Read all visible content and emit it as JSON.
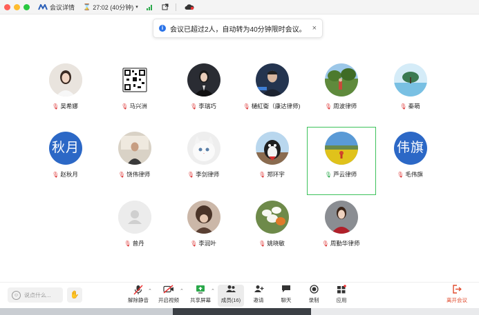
{
  "titlebar": {
    "meeting_details": "会议详情",
    "timer": "27:02 (40分钟)",
    "traffic_colors": [
      "#ff5f57",
      "#febc2e",
      "#28c840"
    ]
  },
  "toast": {
    "message": "会议已超过2人，自动转为40分钟限时会议。",
    "close": "×"
  },
  "participants": [
    {
      "name": "吴希娜",
      "mic": "muted",
      "avatar": "photo"
    },
    {
      "name": "马兴洲",
      "mic": "muted",
      "avatar": "qrcode"
    },
    {
      "name": "李瑞巧",
      "mic": "muted",
      "avatar": "photo"
    },
    {
      "name": "樋紅衛（康达律师)",
      "mic": "muted",
      "avatar": "photo"
    },
    {
      "name": "周波律师",
      "mic": "muted",
      "avatar": "photo"
    },
    {
      "name": "秦萌",
      "mic": "muted",
      "avatar": "photo"
    },
    {
      "name": "赵秋月",
      "mic": "muted",
      "avatar": "text",
      "avatar_text": "秋月"
    },
    {
      "name": "饶伟律师",
      "mic": "muted",
      "avatar": "photo"
    },
    {
      "name": "李剑律师",
      "mic": "muted",
      "avatar": "photo"
    },
    {
      "name": "郑环宇",
      "mic": "muted",
      "avatar": "photo"
    },
    {
      "name": "芦云律师",
      "mic": "on",
      "avatar": "photo",
      "active": true
    },
    {
      "name": "毛伟旗",
      "mic": "muted",
      "avatar": "text",
      "avatar_text": "伟旗"
    },
    {
      "name": "曾丹",
      "mic": "muted",
      "avatar": "default"
    },
    {
      "name": "李润叶",
      "mic": "muted",
      "avatar": "photo"
    },
    {
      "name": "姚晓敏",
      "mic": "muted",
      "avatar": "photo"
    },
    {
      "name": "周勤华律师",
      "mic": "muted",
      "avatar": "photo"
    }
  ],
  "toolbar": {
    "say_placeholder": "说点什么...",
    "unmute": "解除静音",
    "start_video": "开启视频",
    "share_screen": "共享屏幕",
    "members": "成员(16)",
    "invite": "邀请",
    "chat": "聊天",
    "record": "录制",
    "apps": "应用",
    "leave": "离开会议"
  },
  "colors": {
    "accent": "#2c68c6",
    "active_border": "#3cc25a",
    "leave": "#e04b2d"
  }
}
